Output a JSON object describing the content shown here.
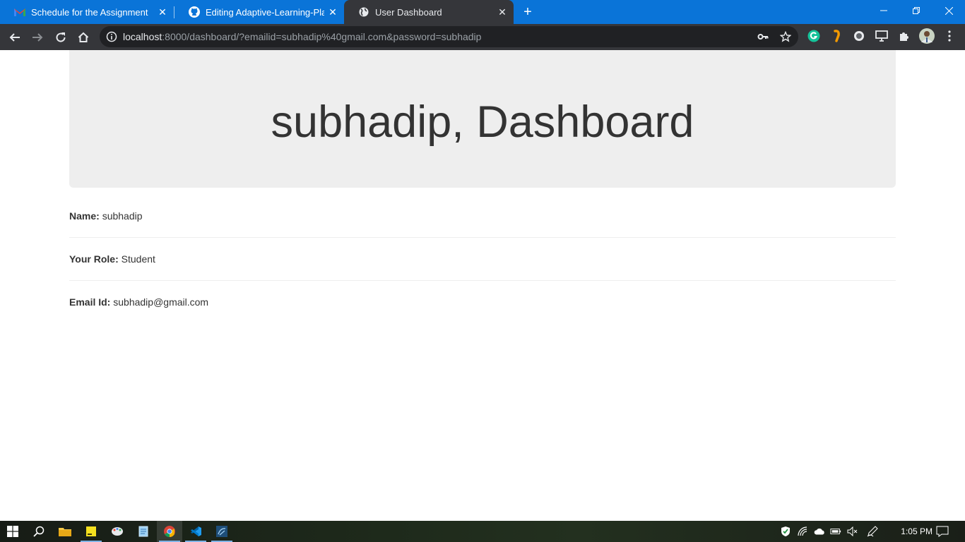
{
  "browser": {
    "tabs": [
      {
        "title": "Schedule for the Assignment of C",
        "icon": "gmail-icon"
      },
      {
        "title": "Editing Adaptive-Learning-Platfo",
        "icon": "github-icon"
      },
      {
        "title": "User Dashboard",
        "icon": "globe-icon"
      }
    ],
    "url": {
      "host": "localhost",
      "rest": ":8000/dashboard/?emailid=subhadip%40gmail.com&password=subhadip"
    }
  },
  "page": {
    "heading": "subhadip, Dashboard",
    "fields": [
      {
        "label": "Name:",
        "value": "subhadip"
      },
      {
        "label": "Your Role:",
        "value": "Student"
      },
      {
        "label": "Email Id:",
        "value": "subhadip@gmail.com"
      }
    ]
  },
  "taskbar": {
    "clock": "1:05 PM"
  },
  "colors": {
    "tabstrip": "#0a74d8",
    "toolbar": "#35363a",
    "jumbotron": "#eeeeee",
    "text": "#333333"
  }
}
